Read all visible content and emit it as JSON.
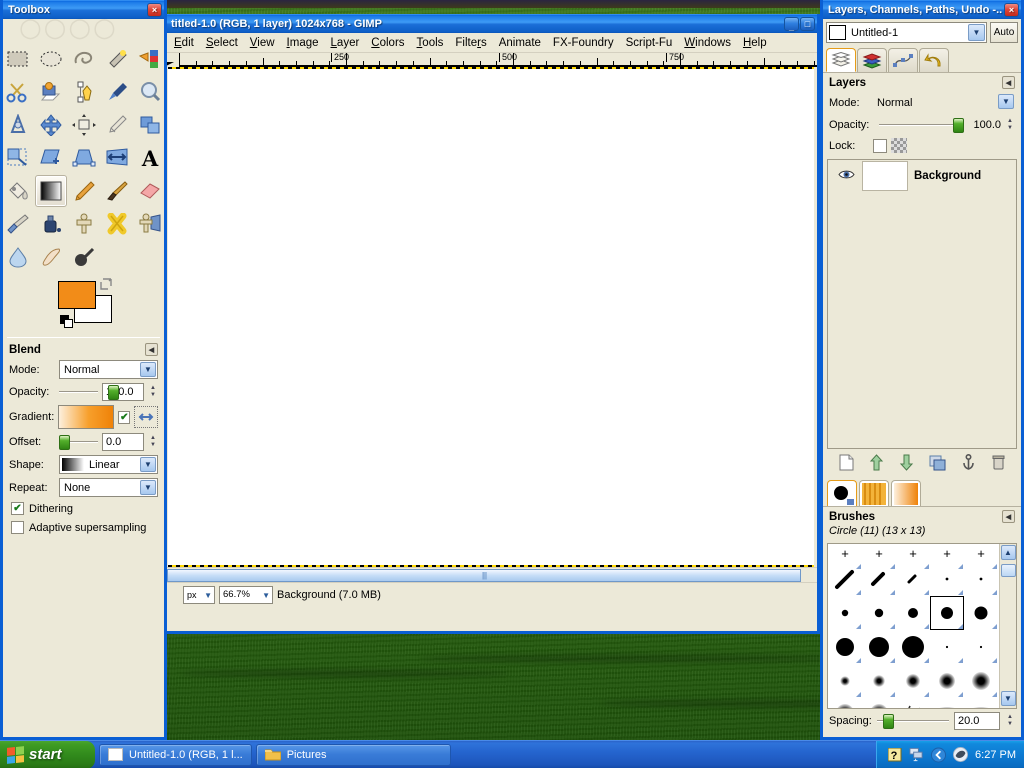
{
  "desktop": {
    "wallpaper_name": "bliss-wallpaper"
  },
  "toolbox": {
    "title": "Toolbox",
    "close_label": "×",
    "tools": [
      {
        "name": "rect-select-tool",
        "label": "Rectangle Select"
      },
      {
        "name": "ellipse-select-tool",
        "label": "Ellipse Select"
      },
      {
        "name": "free-select-tool",
        "label": "Free Select"
      },
      {
        "name": "fuzzy-select-tool",
        "label": "Fuzzy Select"
      },
      {
        "name": "select-by-color-tool",
        "label": "Select by Color"
      },
      {
        "name": "scissors-select-tool",
        "label": "Scissors Select"
      },
      {
        "name": "foreground-select-tool",
        "label": "Foreground Select"
      },
      {
        "name": "paths-tool",
        "label": "Paths"
      },
      {
        "name": "color-picker-tool",
        "label": "Color Picker"
      },
      {
        "name": "zoom-tool",
        "label": "Zoom"
      },
      {
        "name": "measure-tool",
        "label": "Measure"
      },
      {
        "name": "move-tool",
        "label": "Move"
      },
      {
        "name": "align-tool",
        "label": "Alignment"
      },
      {
        "name": "crop-tool",
        "label": "Crop"
      },
      {
        "name": "rotate-tool",
        "label": "Rotate"
      },
      {
        "name": "scale-tool",
        "label": "Scale"
      },
      {
        "name": "shear-tool",
        "label": "Shear"
      },
      {
        "name": "perspective-tool",
        "label": "Perspective"
      },
      {
        "name": "flip-tool",
        "label": "Flip"
      },
      {
        "name": "text-tool",
        "label": "Text"
      },
      {
        "name": "bucket-fill-tool",
        "label": "Bucket Fill"
      },
      {
        "name": "blend-tool",
        "label": "Blend"
      },
      {
        "name": "pencil-tool",
        "label": "Pencil"
      },
      {
        "name": "paintbrush-tool",
        "label": "Paintbrush"
      },
      {
        "name": "eraser-tool",
        "label": "Eraser"
      },
      {
        "name": "airbrush-tool",
        "label": "Airbrush"
      },
      {
        "name": "ink-tool",
        "label": "Ink"
      },
      {
        "name": "clone-tool",
        "label": "Clone"
      },
      {
        "name": "heal-tool",
        "label": "Heal"
      },
      {
        "name": "perspective-clone-tool",
        "label": "Perspective Clone"
      },
      {
        "name": "blur-sharpen-tool",
        "label": "Blur / Sharpen"
      },
      {
        "name": "smudge-tool",
        "label": "Smudge"
      },
      {
        "name": "dodge-burn-tool",
        "label": "Dodge / Burn"
      }
    ],
    "selected_tool": "blend-tool",
    "colors": {
      "foreground": "#f28c18",
      "background": "#ffffff"
    }
  },
  "tool_options": {
    "title": "Blend",
    "mode": {
      "label": "Mode:",
      "value": "Normal"
    },
    "opacity": {
      "label": "Opacity:",
      "value": "100.0"
    },
    "gradient": {
      "label": "Gradient:",
      "reverse_label": "reverse"
    },
    "offset": {
      "label": "Offset:",
      "value": "0.0"
    },
    "shape": {
      "label": "Shape:",
      "value": "Linear"
    },
    "repeat": {
      "label": "Repeat:",
      "value": "None"
    },
    "dithering": {
      "label": "Dithering",
      "checked": true
    },
    "adaptive": {
      "label": "Adaptive supersampling",
      "checked": false
    }
  },
  "image_window": {
    "title": "titled-1.0 (RGB, 1 layer) 1024x768 - GIMP",
    "menus": [
      "Edit",
      "Select",
      "View",
      "Image",
      "Layer",
      "Colors",
      "Tools",
      "Filters",
      "Animate",
      "FX-Foundry",
      "Script-Fu",
      "Windows",
      "Help"
    ],
    "ruler_labels": [
      "250",
      "500",
      "750"
    ],
    "status": {
      "unit": "px",
      "zoom": "66.7%",
      "text": "Background (7.0 MB)"
    },
    "window_buttons": {
      "minimize": "_",
      "maximize": "□",
      "close": "×"
    }
  },
  "dock": {
    "title": "Layers, Channels, Paths, Undo -...",
    "close_label": "×",
    "image_selector": {
      "value": "Untitled-1",
      "auto_label": "Auto"
    },
    "tabs": [
      {
        "name": "tab-layers",
        "label": "Layers"
      },
      {
        "name": "tab-channels",
        "label": "Channels"
      },
      {
        "name": "tab-paths",
        "label": "Paths"
      },
      {
        "name": "tab-undo",
        "label": "Undo History"
      }
    ],
    "active_tab": "tab-layers",
    "layers_panel": {
      "title": "Layers",
      "mode": {
        "label": "Mode:",
        "value": "Normal"
      },
      "opacity": {
        "label": "Opacity:",
        "value": "100.0"
      },
      "lock": {
        "label": "Lock:"
      },
      "layers": [
        {
          "name": "Background",
          "visible": true
        }
      ],
      "buttons": [
        {
          "name": "new-layer-button",
          "label": "New Layer"
        },
        {
          "name": "raise-layer-button",
          "label": "Raise Layer"
        },
        {
          "name": "lower-layer-button",
          "label": "Lower Layer"
        },
        {
          "name": "duplicate-layer-button",
          "label": "Duplicate Layer"
        },
        {
          "name": "anchor-layer-button",
          "label": "Anchor Layer"
        },
        {
          "name": "delete-layer-button",
          "label": "Delete Layer"
        }
      ]
    },
    "brush_tabs": [
      {
        "name": "tab-brushes",
        "label": "Brushes"
      },
      {
        "name": "tab-patterns",
        "label": "Patterns"
      },
      {
        "name": "tab-gradients",
        "label": "Gradients"
      }
    ],
    "active_brush_tab": "tab-brushes",
    "brushes_panel": {
      "title": "Brushes",
      "selected_brush": "Circle (11) (13 x 13)",
      "spacing": {
        "label": "Spacing:",
        "value": "20.0"
      }
    }
  },
  "taskbar": {
    "start_label": "start",
    "items": [
      {
        "name": "taskitem-gimp",
        "label": "Untitled-1.0 (RGB, 1 l..."
      },
      {
        "name": "taskitem-pictures",
        "label": "Pictures"
      }
    ],
    "tray": {
      "icons": [
        "help-icon",
        "network-icon",
        "show-desktop-icon",
        "media-icon"
      ],
      "clock": "6:27 PM"
    }
  }
}
